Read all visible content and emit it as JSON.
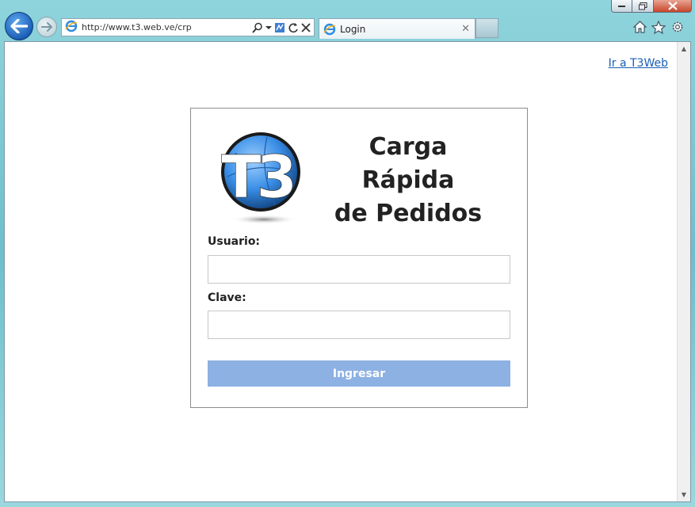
{
  "browser": {
    "url": "http://www.t3.web.ve/crp",
    "tab_title": "Login",
    "window_controls": [
      "minimize",
      "maximize",
      "close"
    ],
    "toolbar_icons": [
      "home-icon",
      "favorites-star-icon",
      "tools-gear-icon"
    ]
  },
  "page": {
    "top_link": "Ir a T3Web",
    "logo_text": "T3",
    "title_line1": "Carga Rápida",
    "title_line2": "de Pedidos",
    "form": {
      "username_label": "Usuario:",
      "username_value": "",
      "password_label": "Clave:",
      "password_value": "",
      "submit_label": "Ingresar",
      "submit_color": "#8db1e2"
    }
  }
}
